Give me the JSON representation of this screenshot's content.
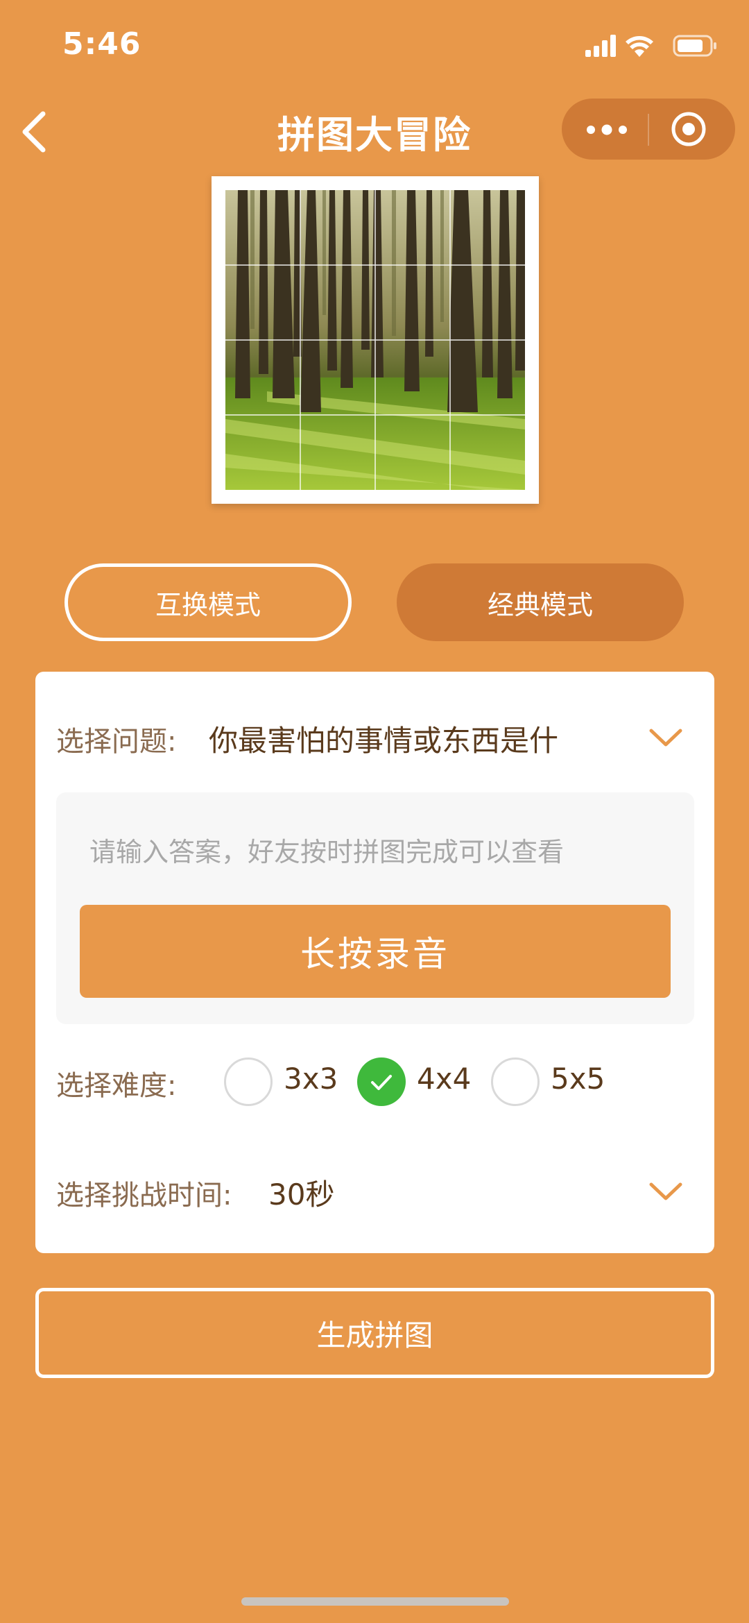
{
  "status_bar": {
    "time": "5:46"
  },
  "nav": {
    "title": "拼图大冒险",
    "back_icon": "chevron-left-icon",
    "more_icon": "more-dots-icon",
    "close_icon": "target-icon"
  },
  "preview": {
    "grid": "4x4",
    "image": "forest-trees-photo"
  },
  "modes": {
    "swap_label": "互换模式",
    "classic_label": "经典模式",
    "selected": "经典模式"
  },
  "question": {
    "label": "选择问题:",
    "value": "你最害怕的事情或东西是什"
  },
  "answer": {
    "placeholder": "请输入答案，好友按时拼图完成可以查看",
    "value": ""
  },
  "record": {
    "label": "长按录音"
  },
  "difficulty": {
    "label": "选择难度:",
    "options": [
      "3x3",
      "4x4",
      "5x5"
    ],
    "selected": "4x4"
  },
  "time": {
    "label": "选择挑战时间:",
    "value": "30秒"
  },
  "generate": {
    "label": "生成拼图"
  },
  "colors": {
    "background": "#e8984a",
    "accent_dark": "#cf7a36",
    "check_green": "#3fb93c"
  }
}
